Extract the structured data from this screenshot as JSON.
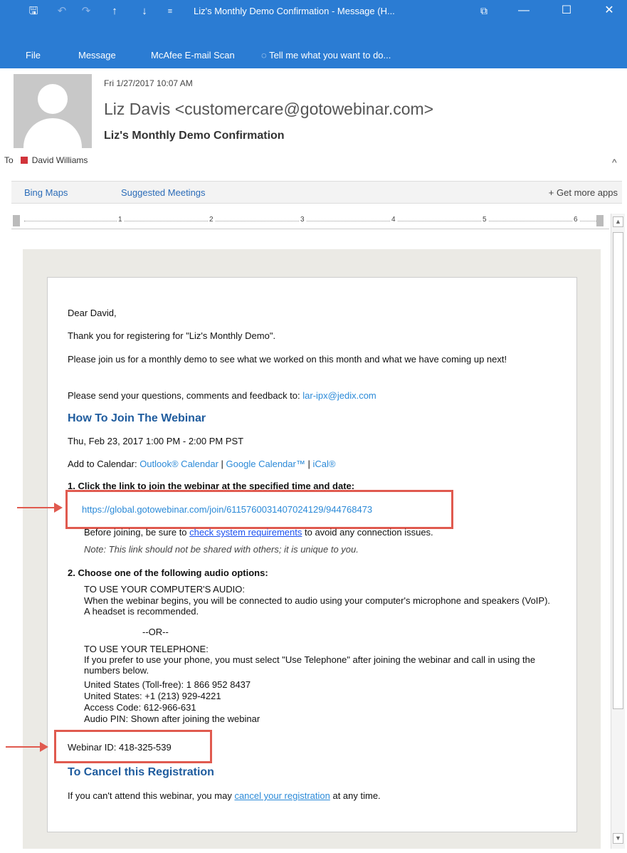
{
  "window": {
    "title": "Liz's Monthly Demo Confirmation - Message (H...",
    "save_glyph": "🖫",
    "undo_glyph": "↶",
    "redo_glyph": "↷",
    "up_glyph": "↑",
    "down_glyph": "↓",
    "more_glyph": "≡",
    "restore_glyph": "⧉",
    "minimize_glyph": "—",
    "maximize_glyph": "☐",
    "close_glyph": "✕"
  },
  "menu": {
    "file": "File",
    "message": "Message",
    "mcafee": "McAfee E-mail Scan",
    "tell_me": "Tell me what you want to do..."
  },
  "header": {
    "datetime": "Fri 1/27/2017 10:07 AM",
    "sender": "Liz Davis <customercare@gotowebinar.com>",
    "subject": "Liz's Monthly Demo Confirmation",
    "to_label": "To",
    "to_name": "David Williams",
    "collapse_glyph": "^"
  },
  "apps": {
    "bing_maps": "Bing Maps",
    "suggested_meetings": "Suggested Meetings",
    "get_more_apps": "+ Get more apps"
  },
  "ruler": {
    "n1": "1",
    "n2": "2",
    "n3": "3",
    "n4": "4",
    "n5": "5",
    "n6": "6"
  },
  "scroll": {
    "up": "▲",
    "down": "▼"
  },
  "email": {
    "greeting": "Dear David,",
    "thanks": "Thank you for registering for \"Liz's Monthly Demo\".",
    "invite": "Please join us for a monthly demo to see what we worked on this month and what we have coming up next!",
    "questions_prefix": "Please send your questions, comments and feedback to: ",
    "questions_email": "lar-ipx@jedix.com",
    "how_to_join": "How To Join The Webinar",
    "datetime": "Thu, Feb 23, 2017 1:00 PM - 2:00 PM PST",
    "add_to_calendar": "Add to Calendar: ",
    "outlook_cal": "Outlook® Calendar",
    "sep1": " | ",
    "google_cal": "Google Calendar™",
    "sep2": " | ",
    "ical": "iCal®",
    "step1": "1. Click the link to join the webinar at the specified time and date:",
    "join_link": "https://global.gotowebinar.com/join/6115760031407024129/944768473",
    "before_prefix": "Before joining, be sure to ",
    "system_req": "check system requirements",
    "before_suffix": " to avoid any connection issues.",
    "note": "Note: This link should not be shared with others; it is unique to you.",
    "step2": "2. Choose one of the following audio options:",
    "computer_audio": "TO USE YOUR COMPUTER'S AUDIO:",
    "computer_desc": "When the webinar begins, you will be connected to audio using your computer's microphone and speakers (VoIP). A headset is recommended.",
    "or": "--OR--",
    "telephone": "TO USE YOUR TELEPHONE:",
    "telephone_desc": "If you prefer to use your phone, you must select \"Use Telephone\" after joining the webinar and call in using the numbers below.",
    "us_tollfree": "United States (Toll-free): 1 866 952 8437",
    "us": "United States: +1 (213) 929-4221",
    "access_code": "Access Code: 612-966-631",
    "audio_pin": "Audio PIN: Shown after joining the webinar",
    "webinar_id": "Webinar ID: 418-325-539",
    "cancel_heading": "To Cancel this Registration",
    "cancel_prefix": "If you can't attend this webinar, you may ",
    "cancel_link": "cancel your registration",
    "cancel_suffix": " at any time."
  },
  "colors": {
    "titlebar": "#2b7cd3",
    "heading": "#1f5c9e",
    "link": "#2b8ad8",
    "highlight": "#e05a4f"
  }
}
